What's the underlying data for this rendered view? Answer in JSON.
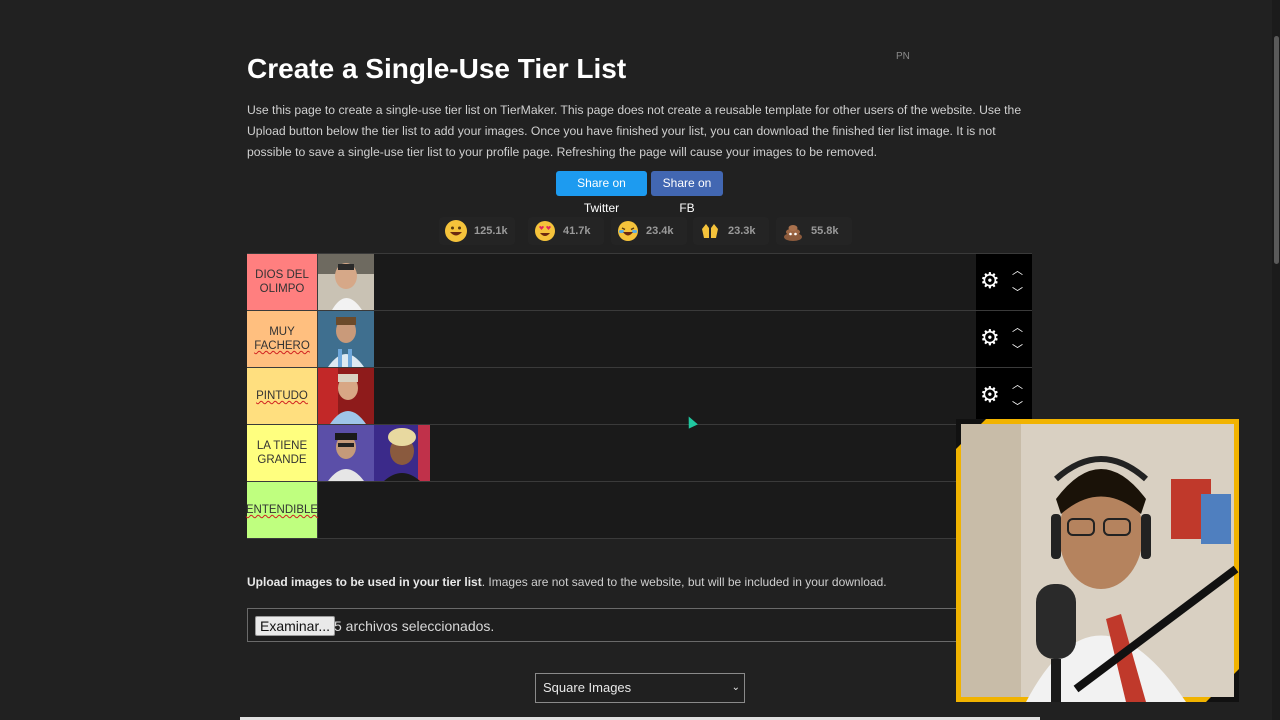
{
  "page": {
    "title": "Create a Single-Use Tier List",
    "pn_label": "PN",
    "intro": "Use this page to create a single-use tier list on TierMaker. This page does not create a reusable template for other users of the website. Use the Upload button below the tier list to add your images. Once you have finished your list, you can download the finished tier list image. It is not possible to save a single-use tier list to your profile page. Refreshing the page will cause your images to be removed."
  },
  "share": {
    "twitter_label": "Share on Twitter",
    "facebook_label": "Share on FB"
  },
  "reactions": [
    {
      "icon": "grinning-face-icon",
      "count": "125.1k"
    },
    {
      "icon": "heart-eyes-face-icon",
      "count": "41.7k"
    },
    {
      "icon": "laughing-tears-face-icon",
      "count": "23.4k"
    },
    {
      "icon": "raising-hands-icon",
      "count": "23.3k"
    },
    {
      "icon": "poop-icon",
      "count": "55.8k"
    }
  ],
  "tiers": [
    {
      "label_line1": "DIOS DEL",
      "label_line2": "OLIMPO",
      "color": "#ff7f7f",
      "image_count": 1
    },
    {
      "label_line1": "MUY",
      "label_line2": "FACHERO",
      "color": "#ffbf7f",
      "image_count": 1
    },
    {
      "label_line1": "PINTUDO",
      "label_line2": "",
      "color": "#ffdf7f",
      "image_count": 1
    },
    {
      "label_line1": "LA TIENE",
      "label_line2": "GRANDE",
      "color": "#ffff7f",
      "image_count": 2
    },
    {
      "label_line1": "ENTENDIBLE",
      "label_line2": "",
      "color": "#bfff7f",
      "image_count": 0
    }
  ],
  "upload": {
    "bold_text": "Upload images to be used in your tier list",
    "rest_text": ". Images are not saved to the website, but will be included in your download.",
    "button_label": "Examinar...",
    "status": "5 archivos seleccionados."
  },
  "image_shape_select": {
    "selected": "Square Images"
  }
}
